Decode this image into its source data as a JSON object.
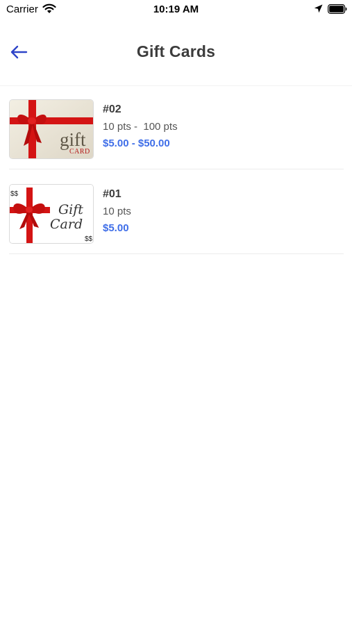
{
  "status_bar": {
    "carrier": "Carrier",
    "time": "10:19 AM",
    "icons": [
      "wifi-icon",
      "location-arrow-icon",
      "battery-icon"
    ]
  },
  "header": {
    "title": "Gift Cards",
    "back_icon": "arrow-left-icon"
  },
  "colors": {
    "accent": "#3f6ee8",
    "back_arrow": "#2e44c8",
    "ribbon": "#d41414"
  },
  "gift_cards": [
    {
      "code": "#02",
      "points": "10 pts -  100 pts",
      "price": "$5.00 - $50.00",
      "image": {
        "word_1": "gift",
        "word_2": "CARD"
      }
    },
    {
      "code": "#01",
      "points": "10 pts",
      "price": "$5.00",
      "image": {
        "word_1": "Gift",
        "word_2": "Card",
        "corner_mark": "$$"
      }
    }
  ]
}
